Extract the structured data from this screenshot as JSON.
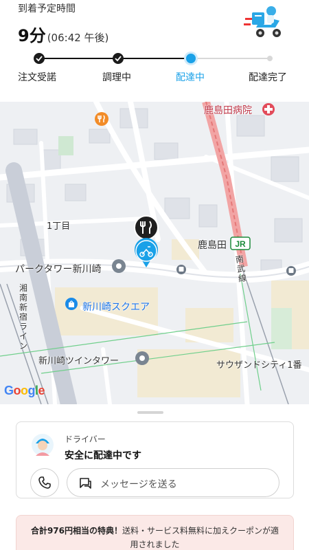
{
  "header": {
    "eta_label": "到着予定時間",
    "eta_minutes": "9分",
    "eta_time": "(06:42 午後)"
  },
  "progress": {
    "steps": [
      {
        "label": "注文受諾",
        "state": "done"
      },
      {
        "label": "調理中",
        "state": "done"
      },
      {
        "label": "配達中",
        "state": "current"
      },
      {
        "label": "配達完了",
        "state": "pending"
      }
    ],
    "accent_color": "#1aa1e8"
  },
  "map": {
    "labels": {
      "hospital": "鹿島田病院",
      "chome": "1丁目",
      "park_tower": "パークタワー新川崎",
      "kashimada": "鹿島田",
      "nanbu": "南武線",
      "shonan": "湘南新宿ライン",
      "square": "新川崎スクエア",
      "twin_tower": "新川崎ツインタワー",
      "thousand": "サウザンドシティ1番"
    },
    "jr_badge": "JR",
    "attribution": "Google"
  },
  "driver": {
    "role": "ドライバー",
    "status": "安全に配達中です",
    "message_label": "メッセージを送る"
  },
  "promo": {
    "bold": "合計976円相当の特典！",
    "text": "送料・サービス料無料に加えクーポンが適用されました"
  }
}
